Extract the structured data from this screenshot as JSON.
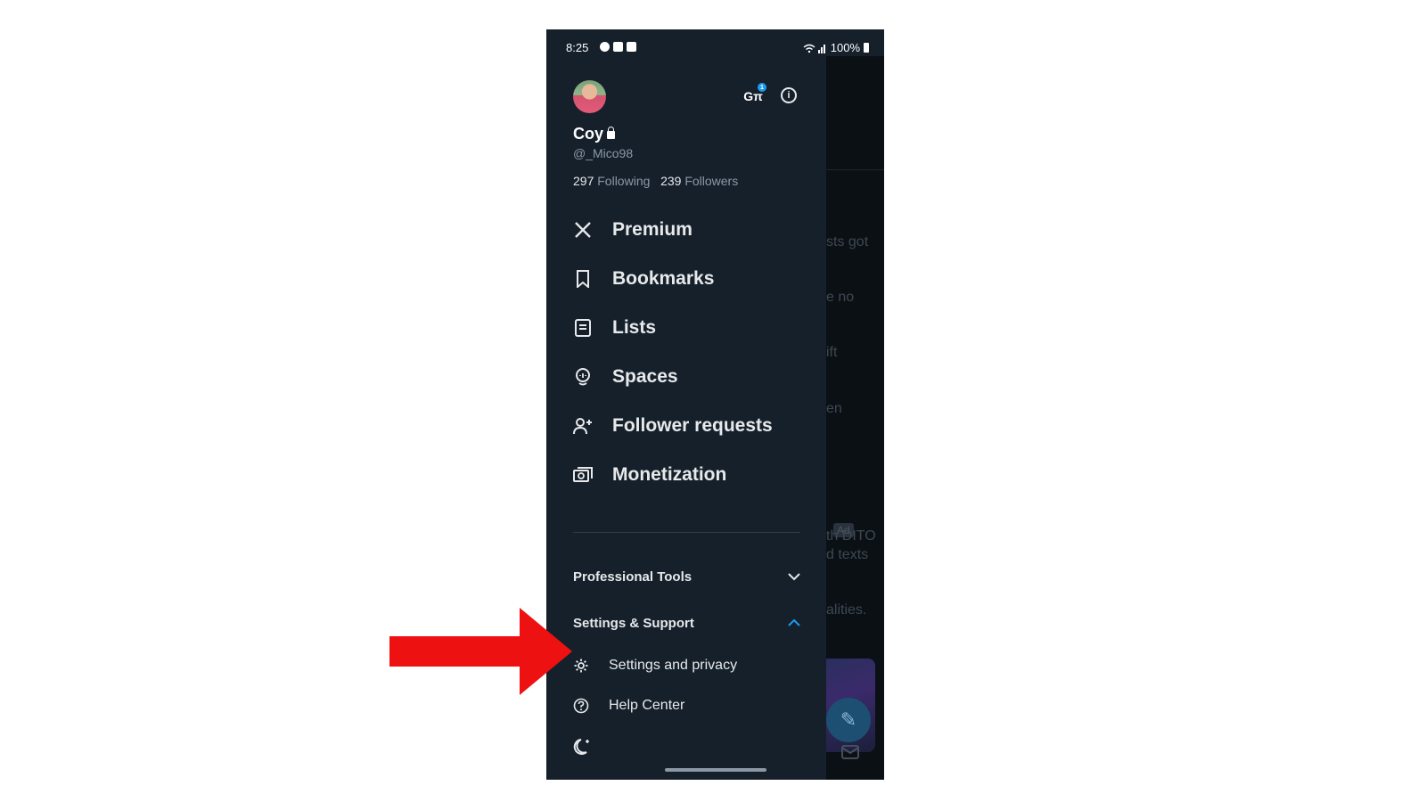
{
  "status_bar": {
    "time": "8:25",
    "battery": "100%"
  },
  "profile": {
    "name": "Coy",
    "handle": "@_Mico98",
    "following_count": "297",
    "following_label": "Following",
    "followers_count": "239",
    "followers_label": "Followers"
  },
  "menu": {
    "items": [
      {
        "label": "Premium",
        "icon": "x-logo-icon"
      },
      {
        "label": "Bookmarks",
        "icon": "bookmark-icon"
      },
      {
        "label": "Lists",
        "icon": "list-icon"
      },
      {
        "label": "Spaces",
        "icon": "spaces-icon"
      },
      {
        "label": "Follower requests",
        "icon": "add-person-icon"
      },
      {
        "label": "Monetization",
        "icon": "monetization-icon"
      }
    ]
  },
  "sections": {
    "professional_tools": "Professional Tools",
    "settings_support": "Settings & Support",
    "settings_items": [
      {
        "label": "Settings and privacy",
        "icon": "gear-icon"
      },
      {
        "label": "Help Center",
        "icon": "help-icon"
      }
    ]
  },
  "background_feed": {
    "fragments": [
      "sts got",
      "e no",
      "ift",
      "en",
      "th DITO",
      "d texts",
      "alities."
    ],
    "ad_badge": "Ad"
  },
  "colors": {
    "drawer_bg": "#15202b",
    "text_primary": "#e7e9ea",
    "text_secondary": "#8b98a5",
    "accent": "#1d9bf0",
    "annotation_arrow": "#ee1111"
  }
}
